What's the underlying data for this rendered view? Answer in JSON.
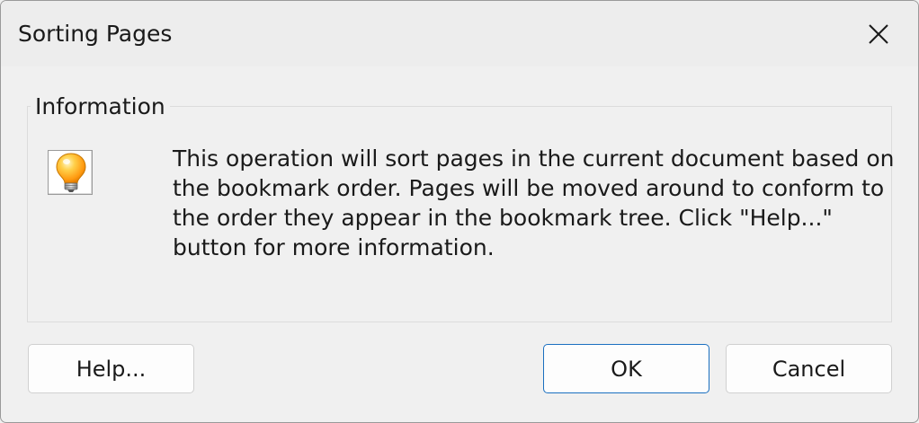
{
  "window": {
    "title": "Sorting Pages"
  },
  "group": {
    "label": "Information",
    "icon": "lightbulb-icon",
    "message_lines": [
      "This operation will sort pages in the current document based on",
      "the bookmark order. Pages will be moved around to conform to",
      "the order they appear in the bookmark tree. Click \"Help...\"",
      "button for more information."
    ]
  },
  "buttons": {
    "help_label": "Help...",
    "ok_label": "OK",
    "cancel_label": "Cancel"
  },
  "colors": {
    "background": "#f0f0f0",
    "default_button_border": "#1a6fc0",
    "bulb": "#ffb020"
  }
}
